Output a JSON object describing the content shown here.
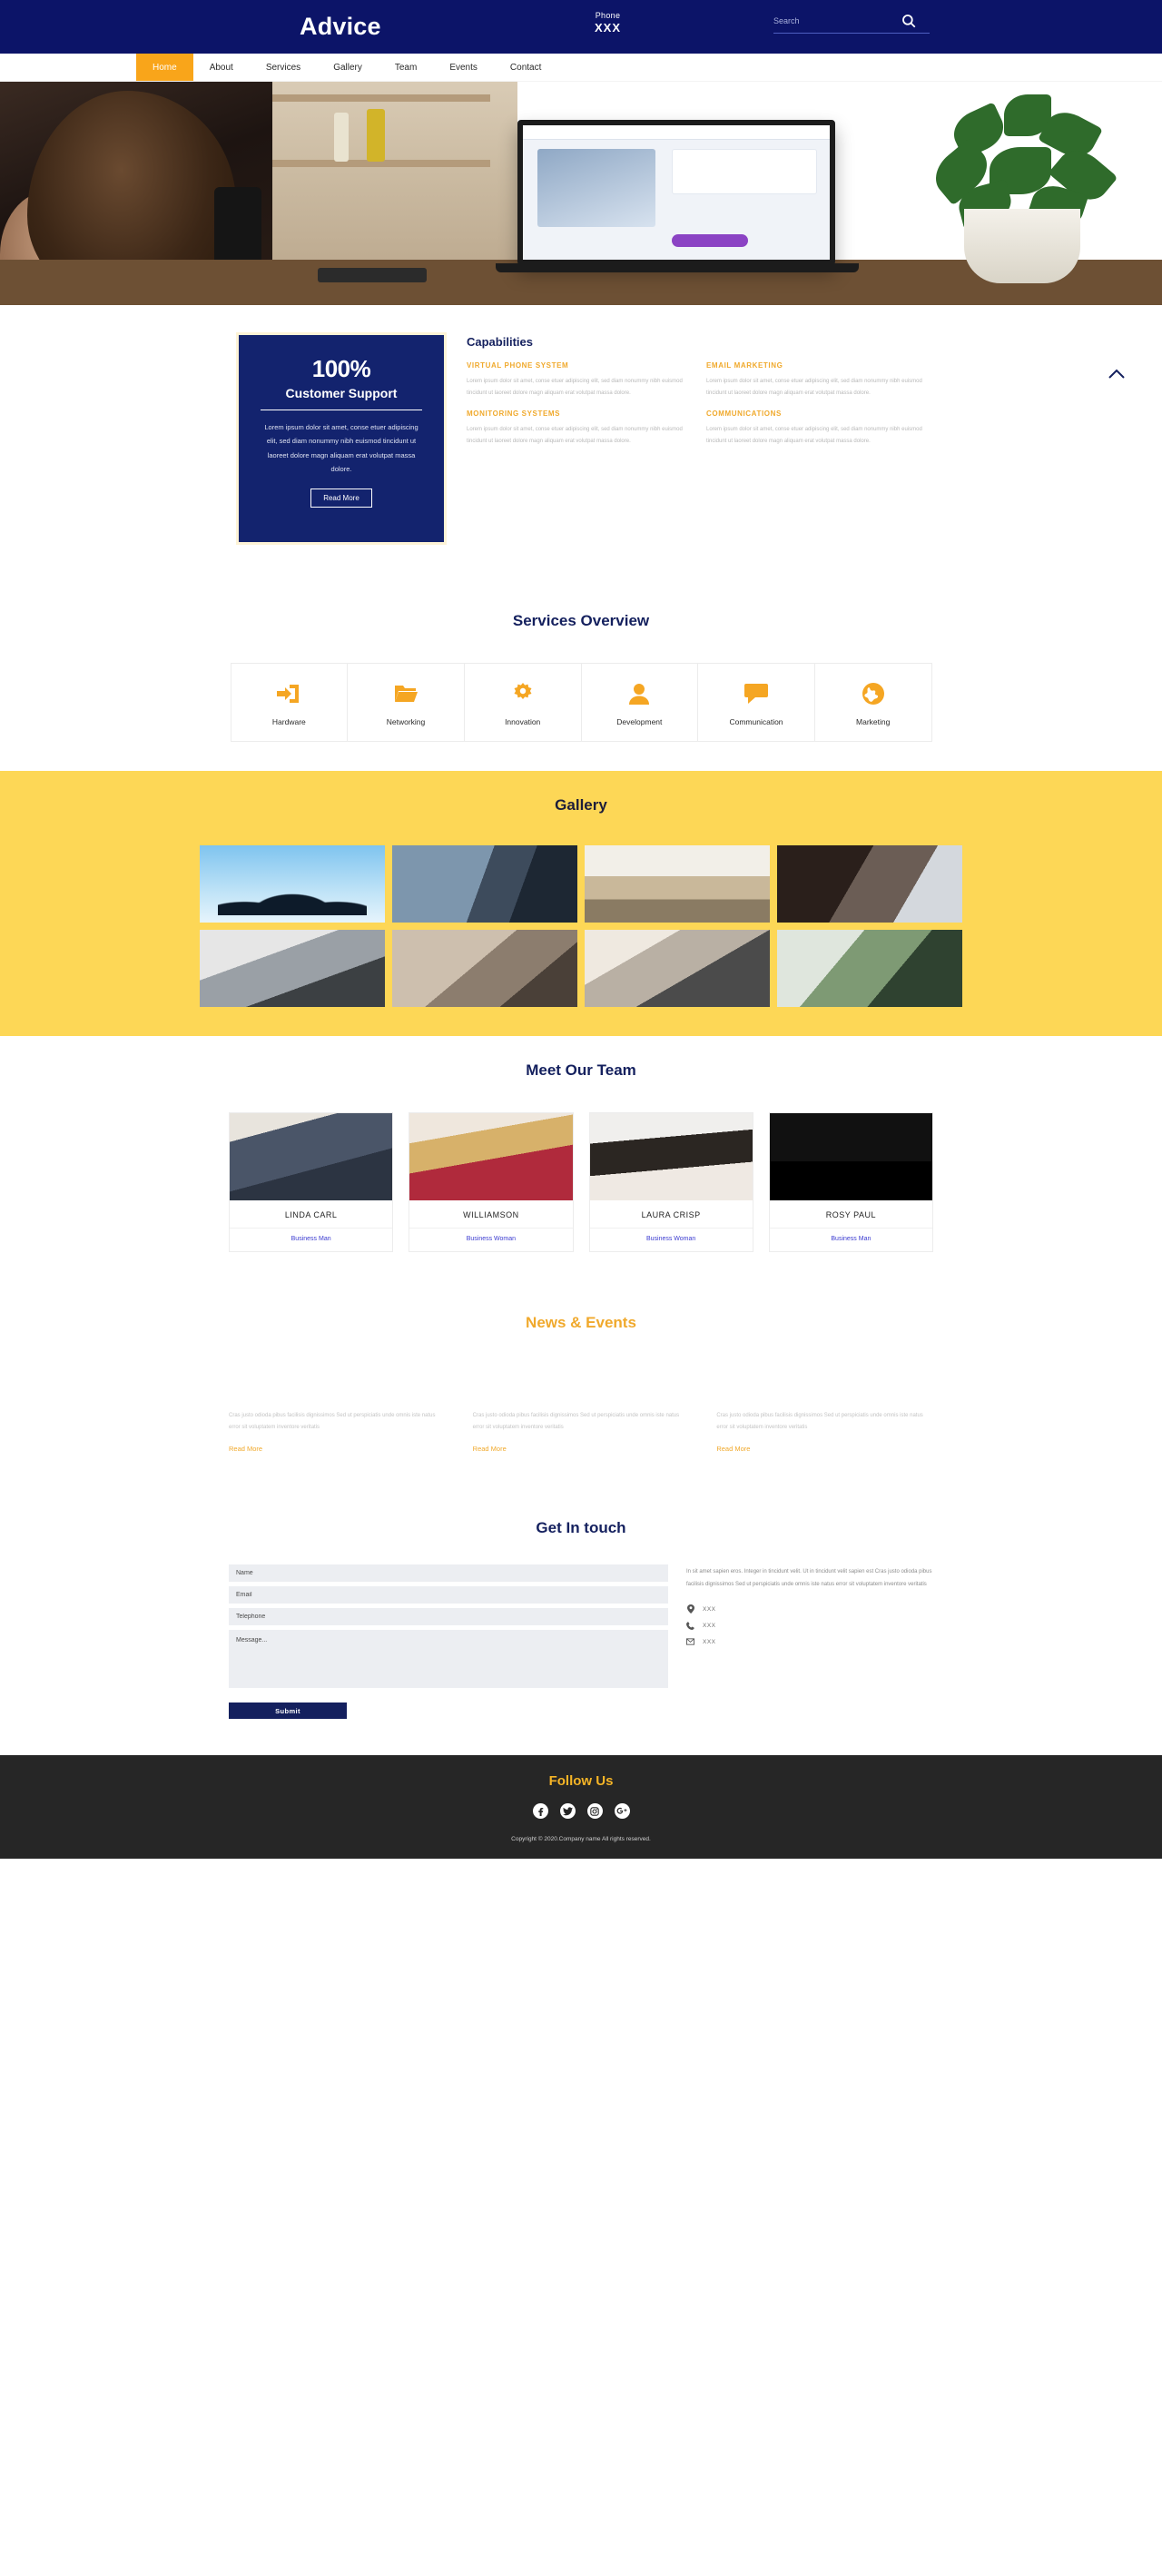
{
  "header": {
    "brand": "Advice",
    "phone_label": "Phone",
    "phone_value": "XXX",
    "search_placeholder": "Search",
    "search_value": ""
  },
  "nav": {
    "items": [
      {
        "label": "Home",
        "active": true
      },
      {
        "label": "About",
        "active": false
      },
      {
        "label": "Services",
        "active": false
      },
      {
        "label": "Gallery",
        "active": false
      },
      {
        "label": "Team",
        "active": false
      },
      {
        "label": "Events",
        "active": false
      },
      {
        "label": "Contact",
        "active": false
      }
    ]
  },
  "capabilities": {
    "card": {
      "percent": "100%",
      "subtitle": "Customer Support",
      "text": "Lorem ipsum dolor sit amet, conse etuer adipiscing elit, sed diam nonummy nibh euismod tincidunt ut laoreet dolore magn aliquam erat volutpat massa dolore.",
      "button": "Read More"
    },
    "title": "Capabilities",
    "items": [
      {
        "heading": "VIRTUAL PHONE SYSTEM",
        "text": "Lorem ipsum dolor sit amet, conse etuer adipiscing elit, sed diam nonummy nibh euismod tincidunt ut laoreet dolore magn aliquam erat volutpat massa dolore."
      },
      {
        "heading": "EMAIL MARKETING",
        "text": "Lorem ipsum dolor sit amet, conse etuer adipiscing elit, sed diam nonummy nibh euismod tincidunt ut laoreet dolore magn aliquam erat volutpat massa dolore."
      },
      {
        "heading": "MONITORING SYSTEMS",
        "text": "Lorem ipsum dolor sit amet, conse etuer adipiscing elit, sed diam nonummy nibh euismod tincidunt ut laoreet dolore magn aliquam erat volutpat massa dolore."
      },
      {
        "heading": "COMMUNICATIONS",
        "text": "Lorem ipsum dolor sit amet, conse etuer adipiscing elit, sed diam nonummy nibh euismod tincidunt ut laoreet dolore magn aliquam erat volutpat massa dolore."
      }
    ]
  },
  "services": {
    "title": "Services Overview",
    "items": [
      {
        "label": "Hardware",
        "icon": "import-arrow-icon"
      },
      {
        "label": "Networking",
        "icon": "folder-icon"
      },
      {
        "label": "Innovation",
        "icon": "gear-icon"
      },
      {
        "label": "Development",
        "icon": "user-icon"
      },
      {
        "label": "Communication",
        "icon": "chat-bubble-icon"
      },
      {
        "label": "Marketing",
        "icon": "globe-icon"
      }
    ]
  },
  "gallery": {
    "title": "Gallery",
    "items": [
      {
        "alt": "business-people-network"
      },
      {
        "alt": "woman-at-office-window"
      },
      {
        "alt": "team-meeting-table"
      },
      {
        "alt": "women-at-computers"
      },
      {
        "alt": "hands-on-laptop"
      },
      {
        "alt": "woman-with-tablet"
      },
      {
        "alt": "man-on-couch-with-laptop"
      },
      {
        "alt": "woman-writing-notes"
      }
    ]
  },
  "team": {
    "title": "Meet Our Team",
    "members": [
      {
        "name": "LINDA CARL",
        "role": "Business Man"
      },
      {
        "name": "WILLIAMSON",
        "role": "Business Woman"
      },
      {
        "name": "LAURA CRISP",
        "role": "Business Woman"
      },
      {
        "name": "ROSY PAUL",
        "role": "Business Man"
      }
    ]
  },
  "news": {
    "title": "News & Events",
    "items": [
      {
        "text": "Cras justo odioda pibus facilisis dignissimos Sed ut perspiciatis unde omnis iste natus error sit voluptatem inventore veritatis",
        "link": "Read More"
      },
      {
        "text": "Cras justo odioda pibus facilisis dignissimos Sed ut perspiciatis unde omnis iste natus error sit voluptatem inventore veritatis",
        "link": "Read More"
      },
      {
        "text": "Cras justo odioda pibus facilisis dignissimos Sed ut perspiciatis unde omnis iste natus error sit voluptatem inventore veritatis",
        "link": "Read More"
      }
    ]
  },
  "contact": {
    "title": "Get In touch",
    "form": {
      "name_placeholder": "Name",
      "name_value": "",
      "email_placeholder": "Email",
      "email_value": "",
      "telephone_placeholder": "Telephone",
      "telephone_value": "",
      "message_placeholder": "Message...",
      "message_value": "",
      "submit_label": "Submit"
    },
    "info": {
      "text": "In sit amet sapien eros. Integer in tincidunt velit. Ut in tincidunt velit sapien est Cras justo odioda pibus facilisis dignissimos Sed ut perspiciatis unde omnis iste natus error sit voluptatem inventore veritatis",
      "items": [
        {
          "icon": "location-pin-icon",
          "value": "XXX"
        },
        {
          "icon": "phone-icon",
          "value": "XXX"
        },
        {
          "icon": "envelope-icon",
          "value": "XXX"
        }
      ]
    }
  },
  "footer": {
    "follow_title": "Follow Us",
    "socials": [
      {
        "name": "facebook-icon"
      },
      {
        "name": "twitter-icon"
      },
      {
        "name": "instagram-icon"
      },
      {
        "name": "google-plus-icon"
      }
    ],
    "copyright": "Copyright © 2020.Company name All rights reserved."
  },
  "colors": {
    "navy": "#0c1468",
    "orange": "#f9a51a",
    "yellow": "#fdd756",
    "footer_dark": "#262626",
    "accent_gold": "#f0a92c"
  }
}
